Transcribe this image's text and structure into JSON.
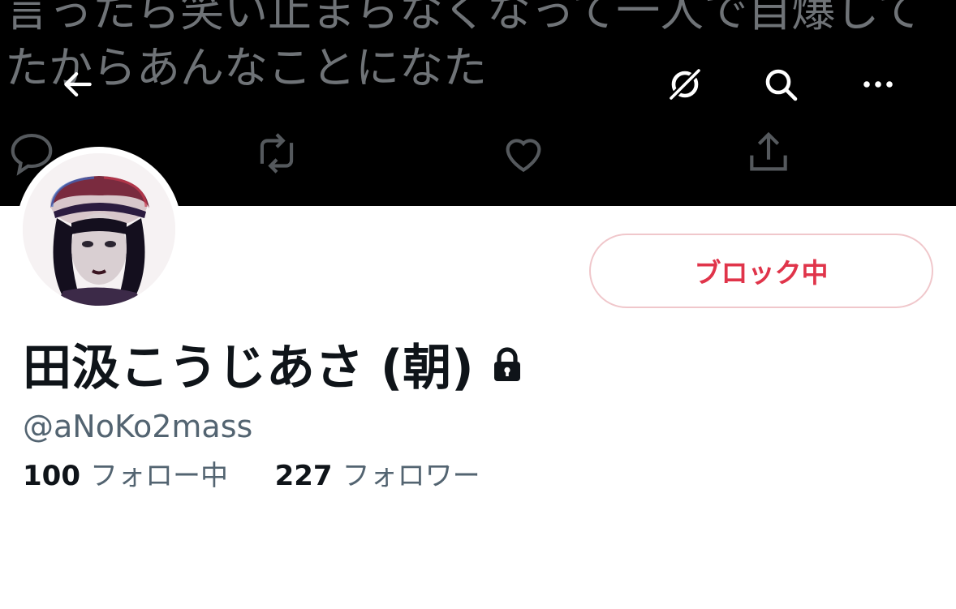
{
  "banner": {
    "text_line1": "言ったら笑い止まらなくなって一人で自爆して",
    "text_line2": "たからあんなことになた"
  },
  "header": {
    "back_icon": "arrow-left-icon",
    "icons": [
      "link-icon",
      "search-icon",
      "more-icon"
    ]
  },
  "profile": {
    "block_label": "ブロック中",
    "display_name": "田汲こうじあさ (朝)",
    "handle": "@aNoKo2mass",
    "following_count": "100",
    "following_label": "フォロー中",
    "followers_count": "227",
    "followers_label": "フォロワー"
  },
  "colors": {
    "block_text": "#e0344a",
    "block_border": "#f0c7cb",
    "secondary_text": "#536471",
    "primary_text": "#0f1419"
  }
}
